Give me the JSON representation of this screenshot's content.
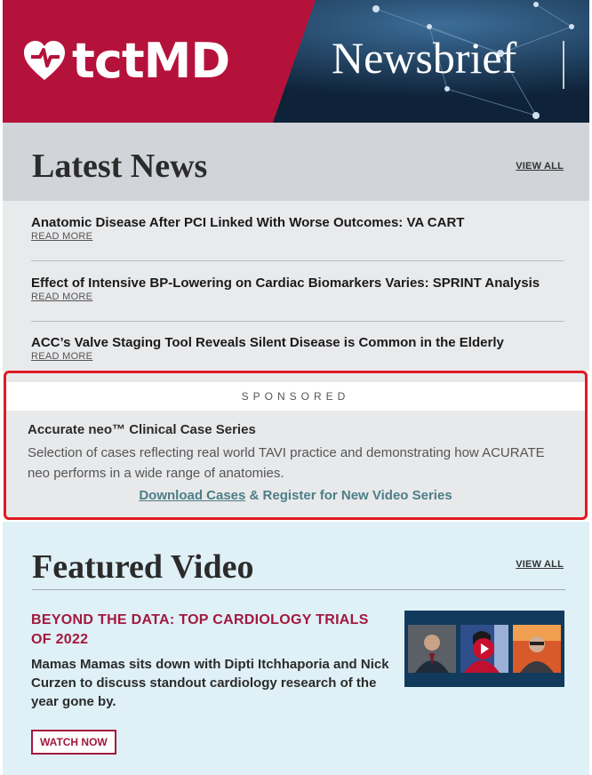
{
  "header": {
    "logo_text": "tctMD",
    "newsbrief": "Newsbrief",
    "colors": {
      "brand_red": "#b5123b",
      "navy": "#0e2238"
    }
  },
  "latest": {
    "title": "Latest News",
    "view_all": "VIEW ALL",
    "items": [
      {
        "title": "Anatomic Disease After PCI Linked With Worse Outcomes: VA CART",
        "read_more": "READ MORE"
      },
      {
        "title": "Effect of Intensive BP-Lowering on Cardiac Biomarkers Varies: SPRINT Analysis",
        "read_more": "READ MORE"
      },
      {
        "title": "ACC’s Valve Staging Tool Reveals Silent Disease is Common in the Elderly",
        "read_more": "READ MORE"
      }
    ]
  },
  "sponsored": {
    "label": "SPONSORED",
    "title": "Accurate neo™ Clinical Case Series",
    "description": "Selection of cases reflecting real world TAVI practice and demonstrating how ACURATE neo performs in a wide range of anatomies.",
    "cta_link": "Download Cases",
    "cta_rest": " & Register for New Video Series"
  },
  "featured": {
    "title": "Featured Video",
    "view_all": "VIEW ALL",
    "video_title": "BEYOND THE DATA: TOP CARDIOLOGY TRIALS OF 2022",
    "video_desc": "Mamas Mamas sits down with Dipti Itchhaporia and Nick Curzen to discuss standout cardiology research of the year gone by.",
    "watch_label": "WATCH NOW",
    "icons": {
      "play": "play-icon",
      "heart": "heart-logo-icon"
    }
  }
}
